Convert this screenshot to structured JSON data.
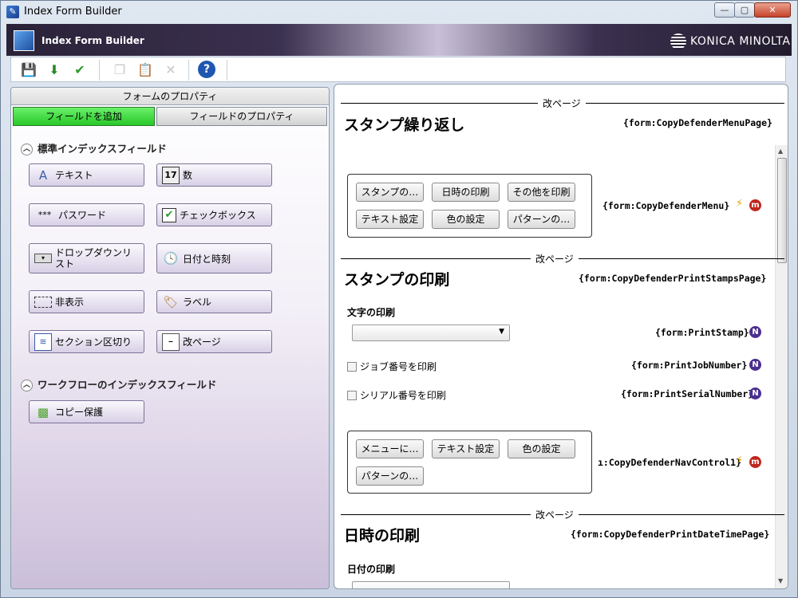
{
  "window": {
    "title": "Index Form Builder",
    "min": "—",
    "max": "▢",
    "close": "✕"
  },
  "banner": {
    "title": "Index Form Builder",
    "brand": "KONICA MINOLTA"
  },
  "left": {
    "form_properties": "フォームのプロパティ",
    "tabs": {
      "add_field": "フィールドを追加",
      "field_properties": "フィールドのプロパティ"
    },
    "standard_section": "標準インデックスフィールド",
    "workflow_section": "ワークフローのインデックスフィールド",
    "buttons": {
      "text": "テキスト",
      "number": "数",
      "password": "パスワード",
      "checkbox": "チェックボックス",
      "dropdown": "ドロップダウンリスト",
      "datetime": "日付と時刻",
      "hidden": "非表示",
      "label": "ラベル",
      "section": "セクション区切り",
      "pagebreak": "改ページ",
      "copyprotect": "コピー保護"
    }
  },
  "right": {
    "pagebreak": "改ページ",
    "s1": {
      "title": "スタンプ繰り返し",
      "tag": "{form:CopyDefenderMenuPage}",
      "buttons": [
        "スタンプの…",
        "日時の印刷",
        "その他を印刷",
        "テキスト設定",
        "色の設定",
        "パターンの…"
      ],
      "menu_tag": "{form:CopyDefenderMenu}"
    },
    "s2": {
      "title": "スタンプの印刷",
      "tag": "{form:CopyDefenderPrintStampsPage}",
      "print_text_label": "文字の印刷",
      "print_stamp_tag": "{form:PrintStamp}",
      "job_label": "ジョブ番号を印刷",
      "job_tag": "{form:PrintJobNumber}",
      "serial_label": "シリアル番号を印刷",
      "serial_tag": "{form:PrintSerialNumber}",
      "buttons": [
        "メニューに…",
        "テキスト設定",
        "色の設定",
        "パターンの…"
      ],
      "nav_tag": "ı:CopyDefenderNavControl1}"
    },
    "s3": {
      "title": "日時の印刷",
      "tag": "{form:CopyDefenderPrintDateTimePage}",
      "date_label": "日付の印刷"
    },
    "badge_n": "N",
    "badge_m": "m"
  }
}
